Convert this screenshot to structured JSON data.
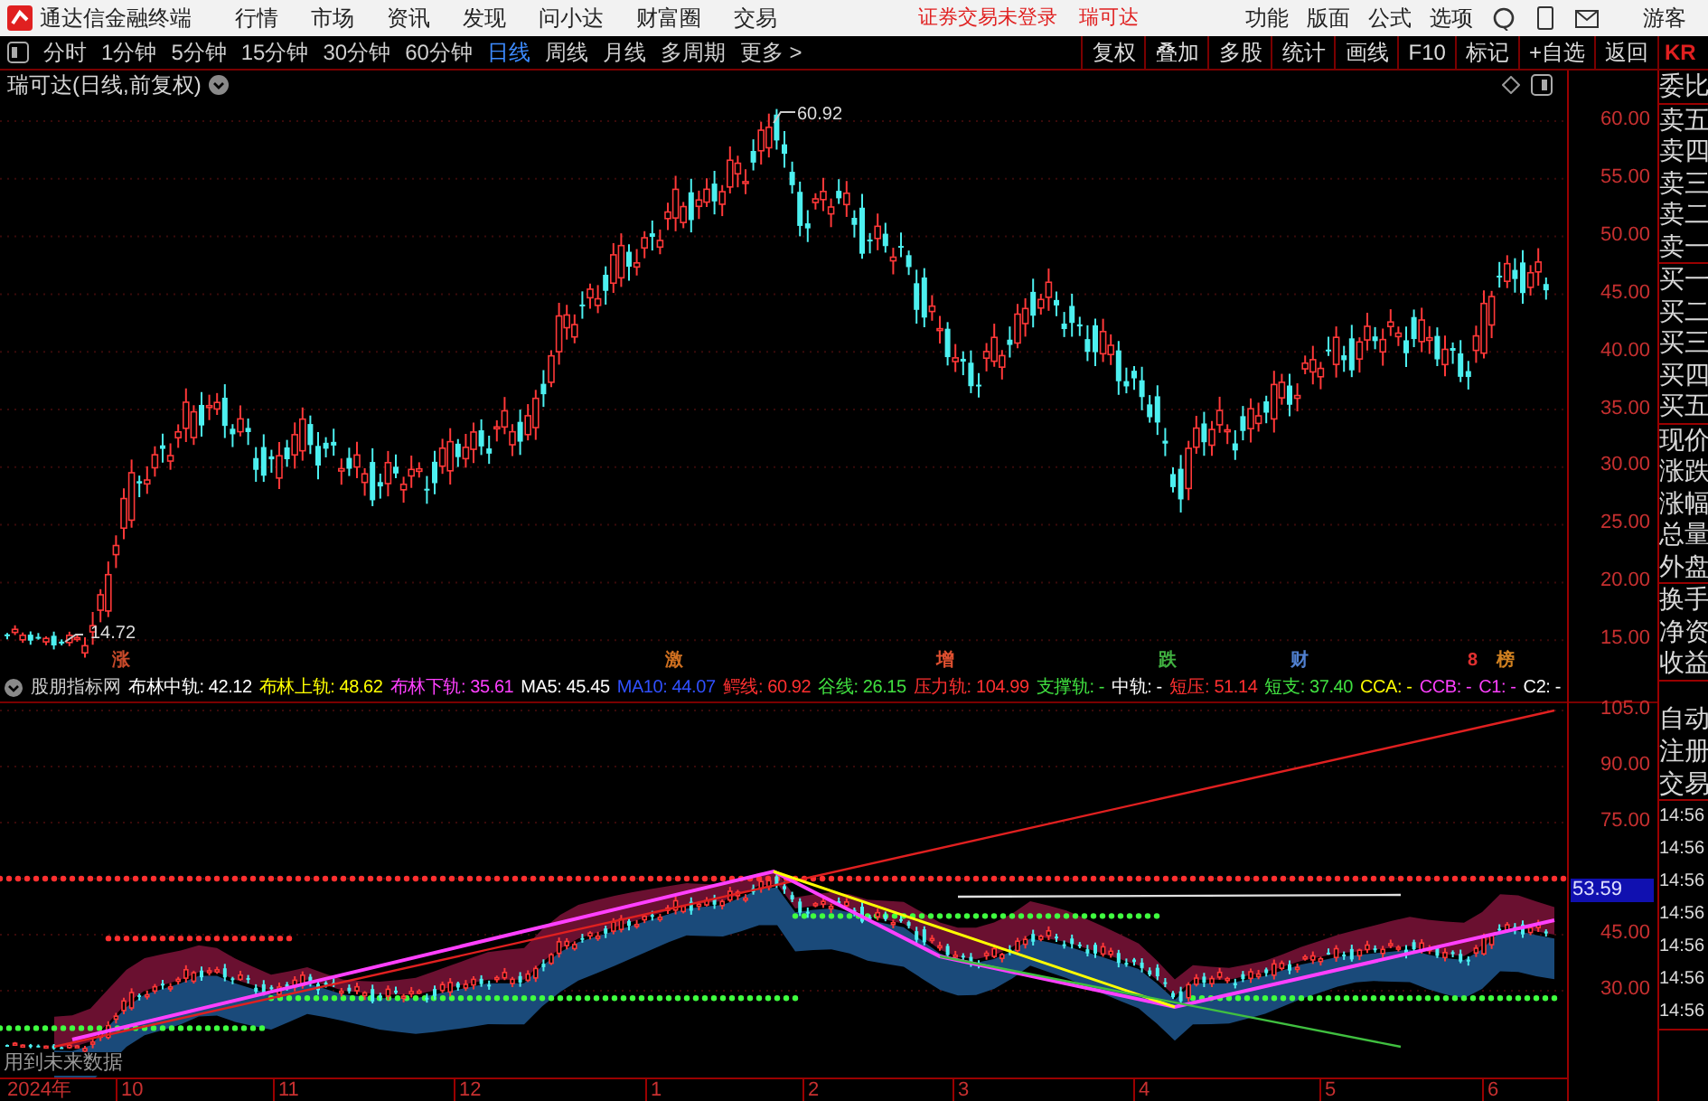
{
  "app_bar": {
    "title": "通达信金融终端",
    "menu": [
      "行情",
      "市场",
      "资讯",
      "发现",
      "问小达",
      "财富圈",
      "交易"
    ],
    "notice": "证券交易未登录",
    "stock": "瑞可达",
    "tools": [
      "功能",
      "版面",
      "公式",
      "选项"
    ],
    "user": "游客"
  },
  "period_bar": {
    "periods": [
      {
        "label": "分时",
        "selected": false
      },
      {
        "label": "1分钟",
        "selected": false
      },
      {
        "label": "5分钟",
        "selected": false
      },
      {
        "label": "15分钟",
        "selected": false
      },
      {
        "label": "30分钟",
        "selected": false
      },
      {
        "label": "60分钟",
        "selected": false
      },
      {
        "label": "日线",
        "selected": true
      },
      {
        "label": "周线",
        "selected": false
      },
      {
        "label": "月线",
        "selected": false
      },
      {
        "label": "多周期",
        "selected": false
      },
      {
        "label": "更多 >",
        "selected": false
      }
    ],
    "actions": [
      "复权",
      "叠加",
      "多股",
      "统计",
      "画线",
      "F10",
      "标记",
      "+自选",
      "返回"
    ],
    "edge_text": "KR"
  },
  "chart_title": "瑞可达(日线,前复权)",
  "price_axis": [
    "60.00",
    "55.00",
    "50.00",
    "45.00",
    "40.00",
    "35.00",
    "30.00",
    "25.00",
    "20.00",
    "15.00"
  ],
  "high_label": "60.92",
  "low_label": "14.72",
  "event_tags": [
    {
      "label": "涨",
      "color": "#c84a2a"
    },
    {
      "label": "激",
      "color": "#d07020"
    },
    {
      "label": "增",
      "color": "#e05030"
    },
    {
      "label": "跌",
      "color": "#40b040"
    },
    {
      "label": "财",
      "color": "#5080d0"
    },
    {
      "label": "8",
      "color": "#e03030"
    },
    {
      "label": "榜",
      "color": "#d08020"
    }
  ],
  "indicator": {
    "name": "股朋指标网",
    "items": [
      {
        "text": "布林中轨: 42.12",
        "color": "#ffffff"
      },
      {
        "text": "布林上轨: 48.62",
        "color": "#ffff00"
      },
      {
        "text": "布林下轨: 35.61",
        "color": "#ff40ff"
      },
      {
        "text": "MA5: 45.45",
        "color": "#ffffff"
      },
      {
        "text": "MA10: 44.07",
        "color": "#3050ff"
      },
      {
        "text": "鳄线: 60.92",
        "color": "#ff3030"
      },
      {
        "text": "谷线: 26.15",
        "color": "#40e040"
      },
      {
        "text": "压力轨: 104.99",
        "color": "#ff3030"
      },
      {
        "text": "支撑轨: -",
        "color": "#40e040"
      },
      {
        "text": "中轨: -",
        "color": "#ffffff"
      },
      {
        "text": "短压: 51.14",
        "color": "#ff3030"
      },
      {
        "text": "短支: 37.40",
        "color": "#40e040"
      },
      {
        "text": "CCA: -",
        "color": "#ffff00"
      },
      {
        "text": "CCB: -",
        "color": "#ff40ff"
      },
      {
        "text": "C1: -",
        "color": "#ff40ff"
      },
      {
        "text": "C2: -",
        "color": "#ffffff"
      }
    ]
  },
  "indicator_axis": [
    "105.0",
    "90.00",
    "75.00",
    "45.00",
    "30.00"
  ],
  "current_value": "53.59",
  "note": "用到未来数据",
  "date_axis": [
    "2024年",
    "10",
    "11",
    "12",
    "1",
    "2",
    "3",
    "4",
    "5",
    "6"
  ],
  "sidebar": {
    "quote_groups": [
      [
        "委比"
      ],
      [
        "卖五",
        "卖四",
        "卖三",
        "卖二",
        "卖一"
      ],
      [
        "买一",
        "买二",
        "买三",
        "买四",
        "买五"
      ],
      [
        "现价",
        "涨跌",
        "涨幅",
        "总量",
        "外盘"
      ],
      [
        "换手",
        "净资",
        "收益"
      ]
    ],
    "lower_groups": [
      [
        "自动",
        "注册",
        "交易"
      ],
      [
        "14:56",
        "14:56",
        "14:56",
        "14:56",
        "14:56",
        "14:56",
        "14:56"
      ]
    ]
  }
}
